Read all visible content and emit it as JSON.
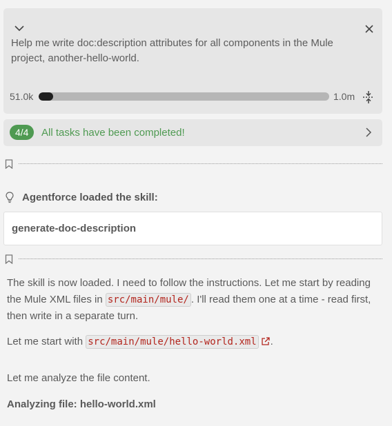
{
  "task": {
    "prompt": "Help me write doc:description attributes for all components in the Mule project, another-hello-world.",
    "tokens_used_label": "51.0k",
    "tokens_max_label": "1.0m",
    "token_usage_fraction": 0.05
  },
  "status": {
    "badge": "4/4",
    "message": "All tasks have been completed!",
    "color": "#4f9a52"
  },
  "skill": {
    "heading": "Agentforce loaded the skill:",
    "name": "generate-doc-description"
  },
  "messages": {
    "p1_before": "The skill is now loaded. I need to follow the instructions. Let me start by reading the Mule XML files in ",
    "p1_code": "src/main/mule/",
    "p1_after": ". I'll read them one at a time - read first, then write in a separate turn.",
    "p2_before": "Let me start with ",
    "p2_code": "src/main/mule/hello-world.xml",
    "p2_after": ".",
    "p3": "Let me analyze the file content.",
    "analyzing": "Analyzing file: hello-world.xml"
  },
  "icons": {
    "collapse": "chevron-down-icon",
    "close": "close-icon",
    "compact": "compress-icon",
    "status_expand": "chevron-right-icon",
    "bookmark": "bookmark-icon",
    "skill": "lightbulb-icon",
    "open_file": "external-link-icon"
  }
}
